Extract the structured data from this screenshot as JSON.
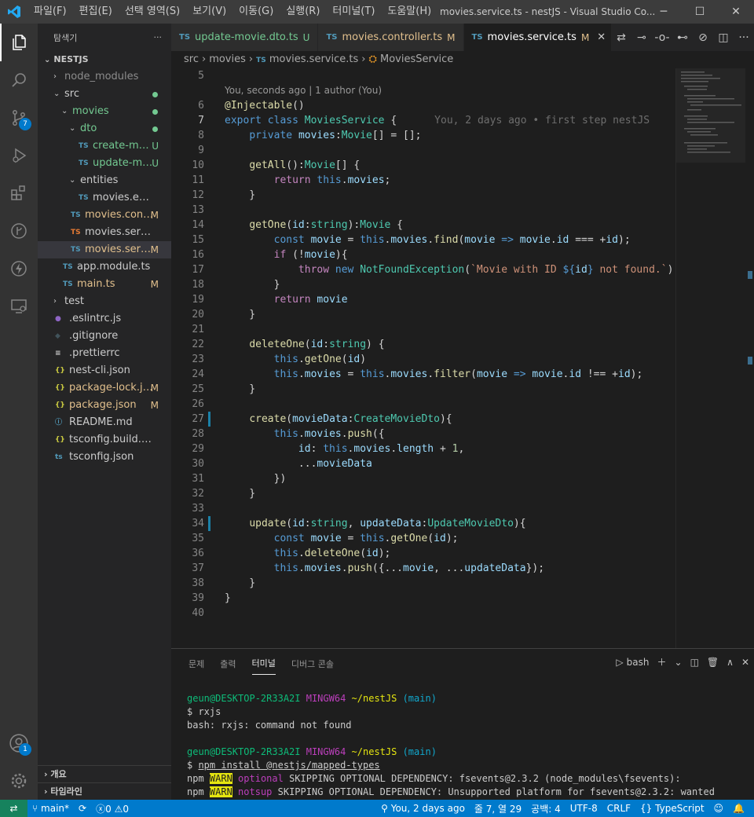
{
  "menu": [
    "파일(F)",
    "편집(E)",
    "선택 영역(S)",
    "보기(V)",
    "이동(G)",
    "실행(R)",
    "터미널(T)",
    "도움말(H)"
  ],
  "window_title": "movies.service.ts - nestJS - Visual Studio Co...",
  "activity": {
    "scm_badge": "7",
    "account_badge": "1"
  },
  "sidebar": {
    "title": "탐색기",
    "more": "···",
    "root": "NESTJS",
    "tree": [
      {
        "label": "node_modules",
        "kind": "folder",
        "depth": 1,
        "open": false,
        "color": "#8c8c8c"
      },
      {
        "label": "src",
        "kind": "folder",
        "depth": 1,
        "open": true,
        "dot": "#73c991"
      },
      {
        "label": "movies",
        "kind": "folder",
        "depth": 2,
        "open": true,
        "color": "#73c991",
        "dot": "#73c991"
      },
      {
        "label": "dto",
        "kind": "folder",
        "depth": 3,
        "open": true,
        "color": "#73c991",
        "dot": "#73c991"
      },
      {
        "label": "create-movi...",
        "kind": "ts",
        "depth": 4,
        "color": "#73c991",
        "status": "U"
      },
      {
        "label": "update-mov...",
        "kind": "ts",
        "depth": 4,
        "color": "#73c991",
        "status": "U"
      },
      {
        "label": "entities",
        "kind": "folder",
        "depth": 3,
        "open": true
      },
      {
        "label": "movies.entity.ts",
        "kind": "ts",
        "depth": 4
      },
      {
        "label": "movies.contr...",
        "kind": "ts",
        "depth": 3,
        "color": "#e2c08d",
        "status": "M"
      },
      {
        "label": "movies.service.spe...",
        "kind": "ts-test",
        "depth": 3
      },
      {
        "label": "movies.servic...",
        "kind": "ts",
        "depth": 3,
        "color": "#e2c08d",
        "status": "M",
        "selected": true
      },
      {
        "label": "app.module.ts",
        "kind": "ts",
        "depth": 2
      },
      {
        "label": "main.ts",
        "kind": "ts",
        "depth": 2,
        "color": "#e2c08d",
        "status": "M"
      },
      {
        "label": "test",
        "kind": "folder",
        "depth": 1,
        "open": false
      },
      {
        "label": ".eslintrc.js",
        "kind": "eslint",
        "depth": 1
      },
      {
        "label": ".gitignore",
        "kind": "git",
        "depth": 1
      },
      {
        "label": ".prettierrc",
        "kind": "lines",
        "depth": 1
      },
      {
        "label": "nest-cli.json",
        "kind": "json",
        "depth": 1
      },
      {
        "label": "package-lock.json",
        "kind": "json",
        "depth": 1,
        "color": "#e2c08d",
        "status": "M"
      },
      {
        "label": "package.json",
        "kind": "json",
        "depth": 1,
        "color": "#e2c08d",
        "status": "M"
      },
      {
        "label": "README.md",
        "kind": "info",
        "depth": 1
      },
      {
        "label": "tsconfig.build.json",
        "kind": "json",
        "depth": 1
      },
      {
        "label": "tsconfig.json",
        "kind": "tsconfig",
        "depth": 1
      }
    ],
    "outline": "개요",
    "timeline": "타임라인"
  },
  "tabs": [
    {
      "label": "update-movie.dto.ts",
      "status": "U",
      "color": "#73c991",
      "active": false
    },
    {
      "label": "movies.controller.ts",
      "status": "M",
      "color": "#e2c08d",
      "active": false
    },
    {
      "label": "movies.service.ts",
      "status": "M",
      "color": "#e2c08d",
      "active": true
    }
  ],
  "breadcrumb": {
    "part1": "src",
    "part2": "movies",
    "file": "movies.service.ts",
    "symbol": "MoviesService"
  },
  "codelens": "You, seconds ago | 1 author (You)",
  "blame": "You, 2 days ago • first step nestJS",
  "code_lines": [
    {
      "n": "5",
      "html": ""
    },
    {
      "n": "6",
      "html": "<span class='d'>@Injectable</span>()"
    },
    {
      "n": "7",
      "html": "<span class='k'>export</span> <span class='k'>class</span> <span class='t'>MoviesService</span> {",
      "cur": true
    },
    {
      "n": "8",
      "html": "    <span class='k'>private</span> <span class='v'>movies</span>:<span class='t'>Movie</span>[] = [];"
    },
    {
      "n": "9",
      "html": ""
    },
    {
      "n": "10",
      "html": "    <span class='f'>getAll</span>():<span class='t'>Movie</span>[] {"
    },
    {
      "n": "11",
      "html": "        <span class='kc'>return</span> <span class='k'>this</span>.<span class='v'>movies</span>;"
    },
    {
      "n": "12",
      "html": "    }"
    },
    {
      "n": "13",
      "html": ""
    },
    {
      "n": "14",
      "html": "    <span class='f'>getOne</span>(<span class='v'>id</span>:<span class='t'>string</span>):<span class='t'>Movie</span> {"
    },
    {
      "n": "15",
      "html": "        <span class='k'>const</span> <span class='v'>movie</span> = <span class='k'>this</span>.<span class='v'>movies</span>.<span class='f'>find</span>(<span class='v'>movie</span> <span class='k'>=&gt;</span> <span class='v'>movie</span>.<span class='v'>id</span> === +<span class='v'>id</span>);"
    },
    {
      "n": "16",
      "html": "        <span class='kc'>if</span> (!<span class='v'>movie</span>){"
    },
    {
      "n": "17",
      "html": "            <span class='kc'>throw</span> <span class='k'>new</span> <span class='t'>NotFoundException</span>(<span class='s'>`Movie with ID </span><span class='k'>${</span><span class='v'>id</span><span class='k'>}</span><span class='s'> not found.`</span>)"
    },
    {
      "n": "18",
      "html": "        }"
    },
    {
      "n": "19",
      "html": "        <span class='kc'>return</span> <span class='v'>movie</span>"
    },
    {
      "n": "20",
      "html": "    }"
    },
    {
      "n": "21",
      "html": ""
    },
    {
      "n": "22",
      "html": "    <span class='f'>deleteOne</span>(<span class='v'>id</span>:<span class='t'>string</span>) {"
    },
    {
      "n": "23",
      "html": "        <span class='k'>this</span>.<span class='f'>getOne</span>(<span class='v'>id</span>)"
    },
    {
      "n": "24",
      "html": "        <span class='k'>this</span>.<span class='v'>movies</span> = <span class='k'>this</span>.<span class='v'>movies</span>.<span class='f'>filter</span>(<span class='v'>movie</span> <span class='k'>=&gt;</span> <span class='v'>movie</span>.<span class='v'>id</span> !== +<span class='v'>id</span>);"
    },
    {
      "n": "25",
      "html": "    }"
    },
    {
      "n": "26",
      "html": ""
    },
    {
      "n": "27",
      "html": "    <span class='f'>create</span>(<span class='v'>movieData</span>:<span class='t'>CreateMovieDto</span>){",
      "mod": true
    },
    {
      "n": "28",
      "html": "        <span class='k'>this</span>.<span class='v'>movies</span>.<span class='f'>push</span>({"
    },
    {
      "n": "29",
      "html": "            <span class='v'>id</span>: <span class='k'>this</span>.<span class='v'>movies</span>.<span class='v'>length</span> + <span class='n'>1</span>,"
    },
    {
      "n": "30",
      "html": "            ...<span class='v'>movieData</span>"
    },
    {
      "n": "31",
      "html": "        })"
    },
    {
      "n": "32",
      "html": "    }"
    },
    {
      "n": "33",
      "html": ""
    },
    {
      "n": "34",
      "html": "    <span class='f'>update</span>(<span class='v'>id</span>:<span class='t'>string</span>, <span class='v'>updateData</span>:<span class='t'>UpdateMovieDto</span>){",
      "mod": true
    },
    {
      "n": "35",
      "html": "        <span class='k'>const</span> <span class='v'>movie</span> = <span class='k'>this</span>.<span class='f'>getOne</span>(<span class='v'>id</span>);"
    },
    {
      "n": "36",
      "html": "        <span class='k'>this</span>.<span class='f'>deleteOne</span>(<span class='v'>id</span>);"
    },
    {
      "n": "37",
      "html": "        <span class='k'>this</span>.<span class='v'>movies</span>.<span class='f'>push</span>({...<span class='v'>movie</span>, ...<span class='v'>updateData</span>});"
    },
    {
      "n": "38",
      "html": "    }"
    },
    {
      "n": "39",
      "html": "}"
    },
    {
      "n": "40",
      "html": ""
    }
  ],
  "panel": {
    "tabs": [
      "문제",
      "출력",
      "터미널",
      "디버그 콘솔"
    ],
    "active_tab": "터미널",
    "shell": "bash"
  },
  "terminal_lines": [
    "",
    "<span class='tg'>geun@DESKTOP-2R33A2I</span> <span class='tm'>MINGW64</span> <span class='ty'>~/nestJS</span> <span class='tc'>(main)</span>",
    "$ rxjs",
    "bash: rxjs: command not found",
    "",
    "<span class='tg'>geun@DESKTOP-2R33A2I</span> <span class='tm'>MINGW64</span> <span class='ty'>~/nestJS</span> <span class='tc'>(main)</span>",
    "$ <u>npm install @nestjs/mapped-types</u>",
    "npm <span class='warn'>WARN</span> <span class='tmag'>optional</span> SKIPPING OPTIONAL DEPENDENCY: fsevents@2.3.2 (node_modules\\fsevents):",
    "npm <span class='warn'>WARN</span> <span class='tmag'>notsup</span> SKIPPING OPTIONAL DEPENDENCY: Unsupported platform for fsevents@2.3.2: wanted"
  ],
  "status": {
    "branch": "main*",
    "errors": "0",
    "warnings": "0",
    "blame": "You, 2 days ago",
    "position": "줄 7, 열 29",
    "spaces": "공백: 4",
    "encoding": "UTF-8",
    "eol": "CRLF",
    "language": "TypeScript"
  },
  "colors": {
    "accent": "#007acc",
    "modified": "#e2c08d",
    "untracked": "#73c991"
  }
}
